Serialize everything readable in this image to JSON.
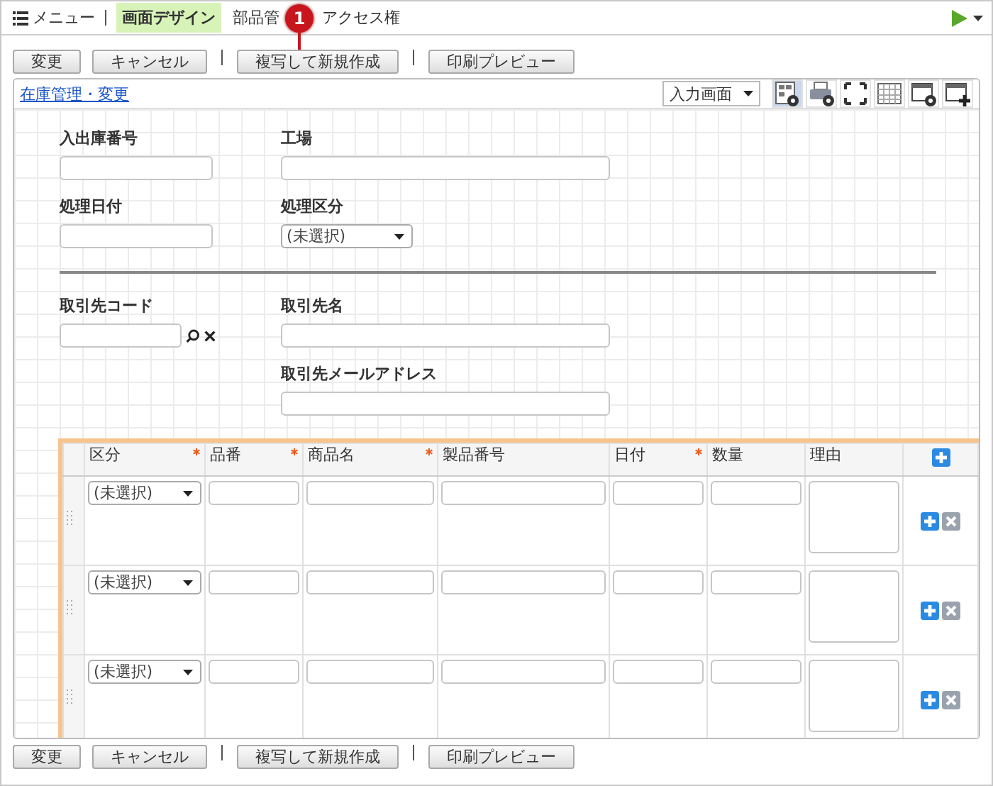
{
  "top_bar": {
    "menu_label": "メニュー",
    "tabs": [
      {
        "label": "画面デザイン",
        "selected": true
      },
      {
        "label": "部品管",
        "selected": false
      },
      {
        "label": "アクセス権",
        "selected": false
      }
    ]
  },
  "callout": "1",
  "actions_top": [
    "変更",
    "キャンセル",
    "複写して新規作成",
    "印刷プレビュー"
  ],
  "panel": {
    "link": "在庫管理・変更",
    "view_select": "入力画面",
    "form_rows": [
      {
        "kind": "fields",
        "fields": [
          {
            "kind": "text",
            "label": "入出庫番号"
          },
          {
            "kind": "text",
            "label": "工場"
          }
        ]
      },
      {
        "kind": "fields",
        "fields": [
          {
            "kind": "text",
            "label": "処理日付"
          },
          {
            "kind": "select",
            "label": "処理区分",
            "value": "(未選択)"
          }
        ]
      },
      {
        "kind": "divider"
      },
      {
        "kind": "fields",
        "fields": [
          {
            "kind": "lookup",
            "label": "取引先コード"
          },
          {
            "kind": "text",
            "label": "取引先名"
          }
        ]
      },
      {
        "kind": "fields",
        "fields": [
          {
            "kind": "blank"
          },
          {
            "kind": "text",
            "label": "取引先メールアドレス"
          }
        ]
      }
    ],
    "table": {
      "columns": [
        {
          "label": "区分",
          "required": true
        },
        {
          "label": "品番",
          "required": true
        },
        {
          "label": "商品名",
          "required": true
        },
        {
          "label": "製品番号",
          "required": false
        },
        {
          "label": "日付",
          "required": true
        },
        {
          "label": "数量",
          "required": false
        },
        {
          "label": "理由",
          "required": false
        }
      ],
      "rows": [
        {
          "cells": [
            {
              "kind": "select",
              "value": "(未選択)"
            },
            {
              "kind": "text"
            },
            {
              "kind": "text"
            },
            {
              "kind": "text"
            },
            {
              "kind": "text"
            },
            {
              "kind": "text"
            },
            {
              "kind": "textarea"
            }
          ]
        },
        {
          "cells": [
            {
              "kind": "select",
              "value": "(未選択)"
            },
            {
              "kind": "text"
            },
            {
              "kind": "text"
            },
            {
              "kind": "text"
            },
            {
              "kind": "text"
            },
            {
              "kind": "text"
            },
            {
              "kind": "textarea"
            }
          ]
        },
        {
          "cells": [
            {
              "kind": "select",
              "value": "(未選択)"
            },
            {
              "kind": "text"
            },
            {
              "kind": "text"
            },
            {
              "kind": "text"
            },
            {
              "kind": "text"
            },
            {
              "kind": "text"
            },
            {
              "kind": "textarea"
            }
          ]
        }
      ]
    }
  },
  "actions_bottom": [
    "変更",
    "キャンセル",
    "複写して新規作成",
    "印刷プレビュー"
  ]
}
